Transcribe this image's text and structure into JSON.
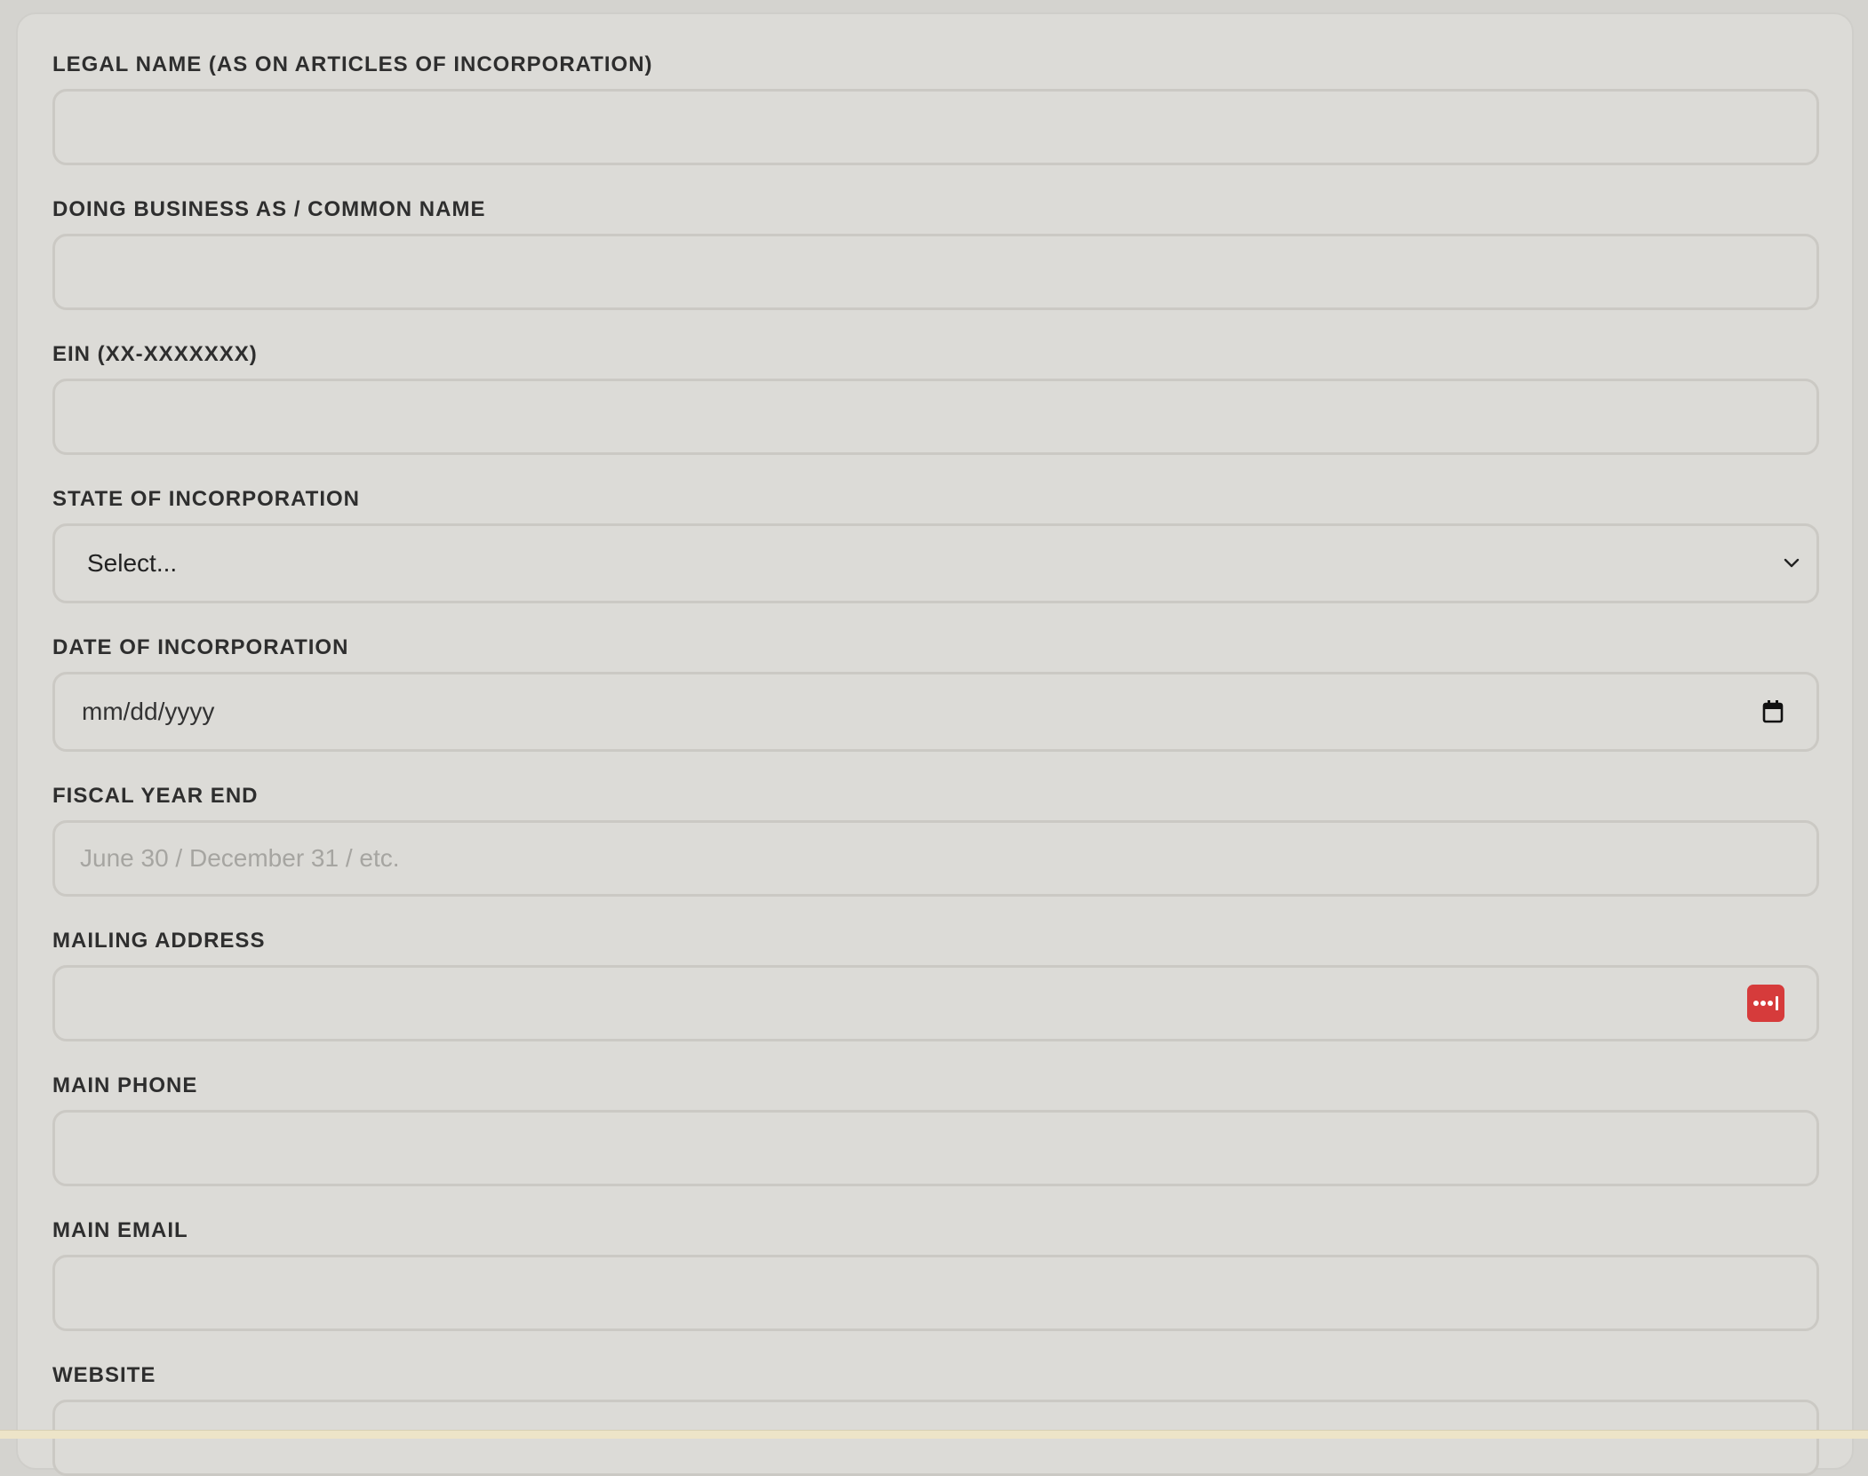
{
  "form": {
    "legal_name": {
      "label": "LEGAL NAME (AS ON ARTICLES OF INCORPORATION)",
      "value": ""
    },
    "dba": {
      "label": "DOING BUSINESS AS / COMMON NAME",
      "value": ""
    },
    "ein": {
      "label": "EIN (XX-XXXXXXX)",
      "value": ""
    },
    "state": {
      "label": "STATE OF INCORPORATION",
      "selected": "Select..."
    },
    "date": {
      "label": "DATE OF INCORPORATION",
      "display": "mm/dd/yyyy"
    },
    "fiscal_year_end": {
      "label": "FISCAL YEAR END",
      "placeholder": "June 30 / December 31 / etc."
    },
    "mailing_address": {
      "label": "MAILING ADDRESS",
      "value": ""
    },
    "main_phone": {
      "label": "MAIN PHONE",
      "value": ""
    },
    "main_email": {
      "label": "MAIN EMAIL",
      "value": ""
    },
    "website": {
      "label": "WEBSITE",
      "value": ""
    }
  },
  "icons": {
    "select_arrow": "chevron-down-icon",
    "date_picker": "calendar-icon",
    "password_manager": "password-manager-icon"
  },
  "colors": {
    "page_background": "#d4d3cf",
    "card_background": "#dcdbd7",
    "input_border": "#cbc9c4",
    "label_text": "#2e2e2e",
    "placeholder_text": "#a6a5a1",
    "password_manager_badge": "#d63b3b"
  }
}
